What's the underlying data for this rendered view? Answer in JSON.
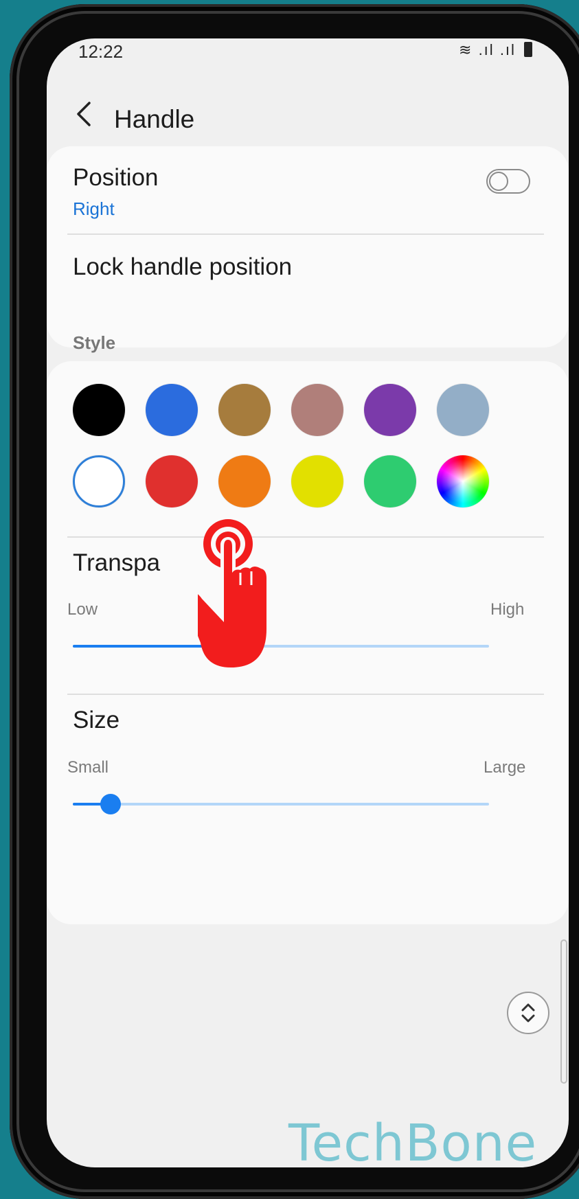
{
  "status_bar": {
    "time": "12:22",
    "icons": [
      "wifi-icon",
      "signal-icon",
      "signal-icon",
      "battery-icon"
    ]
  },
  "app_bar": {
    "title": "Handle",
    "back_icon": "chevron-left-icon"
  },
  "position": {
    "label": "Position",
    "value": "Right"
  },
  "lock_handle": {
    "label": "Lock handle position",
    "enabled": false
  },
  "style": {
    "header": "Style",
    "swatches": [
      {
        "color": "#000000"
      },
      {
        "color": "#2b6cde"
      },
      {
        "color": "#a67c3d"
      },
      {
        "color": "#b07f7a"
      },
      {
        "color": "#7b3aaa"
      },
      {
        "color": "#93aec7"
      },
      {
        "color": "#ffffff",
        "selected": true
      },
      {
        "color": "#e0302e"
      },
      {
        "color": "#ef7b14"
      },
      {
        "color": "#e2e000"
      },
      {
        "color": "#2ecc70"
      },
      {
        "color": "rainbow",
        "icon": "color-picker-icon"
      }
    ]
  },
  "transparency": {
    "label": "Transpa",
    "low": "Low",
    "high": "High",
    "value": 0.41
  },
  "size": {
    "label": "Size",
    "low": "Small",
    "high": "Large",
    "value": 0.09
  },
  "colors": {
    "accent": "#1a7ef0",
    "link": "#1a73d6",
    "track_inactive": "#b3d6f8"
  },
  "overlay": {
    "icon": "tap-hand-icon",
    "color": "#f21d1d"
  },
  "watermark": "TechBone"
}
